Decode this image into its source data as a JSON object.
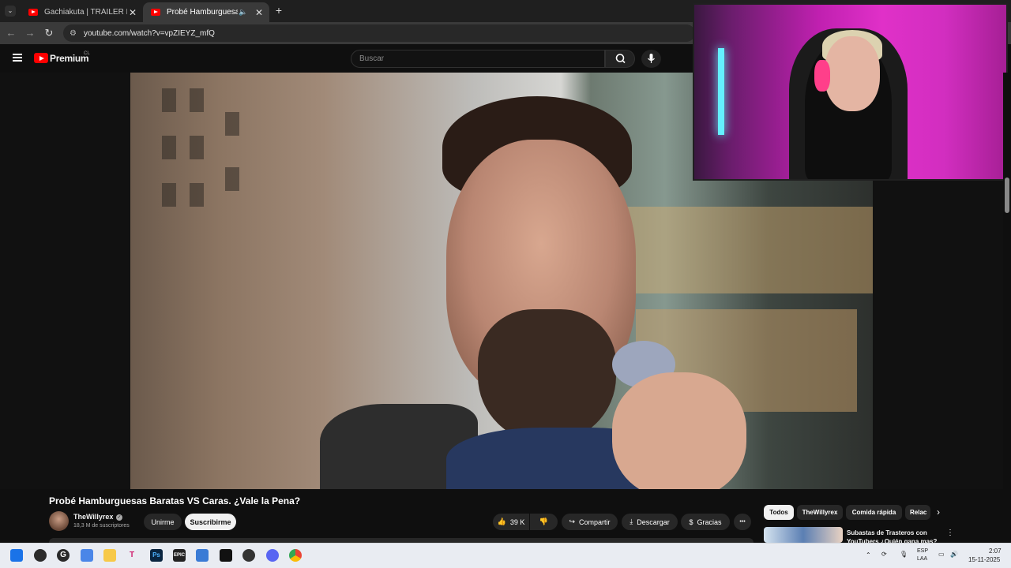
{
  "browser": {
    "tabs": [
      {
        "title": "Gachiakuta | TRÁILER EN ESPAÑOL",
        "active": false
      },
      {
        "title": "Probé Hamburguesas Baratas VS Caras",
        "active": true
      }
    ],
    "url": "youtube.com/watch?v=vpZIEYZ_mfQ",
    "new_tab": "+",
    "close": "✕"
  },
  "youtube": {
    "brand": "Premium",
    "country_code": "CL",
    "search_placeholder": "Buscar"
  },
  "video": {
    "title": "Probé Hamburguesas Baratas VS Caras. ¿Vale la Pena?",
    "channel": "TheWillyrex",
    "subscribers": "18,3 M de suscriptores",
    "join_label": "Unirme",
    "subscribe_label": "Suscribirme",
    "likes": "39 K",
    "share_label": "Compartir",
    "download_label": "Descargar",
    "thanks_label": "Gracias",
    "more": "•••"
  },
  "related": {
    "chips": [
      "Todos",
      "TheWillyrex",
      "Comida rápida",
      "Relac"
    ],
    "first_title": "Subastas de Trasteros con YouTubers ¿Quién gana mas?"
  },
  "taskbar": {
    "language": "ESP",
    "layout": "LAA",
    "time": "2:07",
    "date": "15-11-2025"
  },
  "colors": {
    "yt_red": "#ff0000",
    "background": "#0f0f0f",
    "chip_active": "#f1f1f1",
    "chip_inactive": "#272727"
  }
}
